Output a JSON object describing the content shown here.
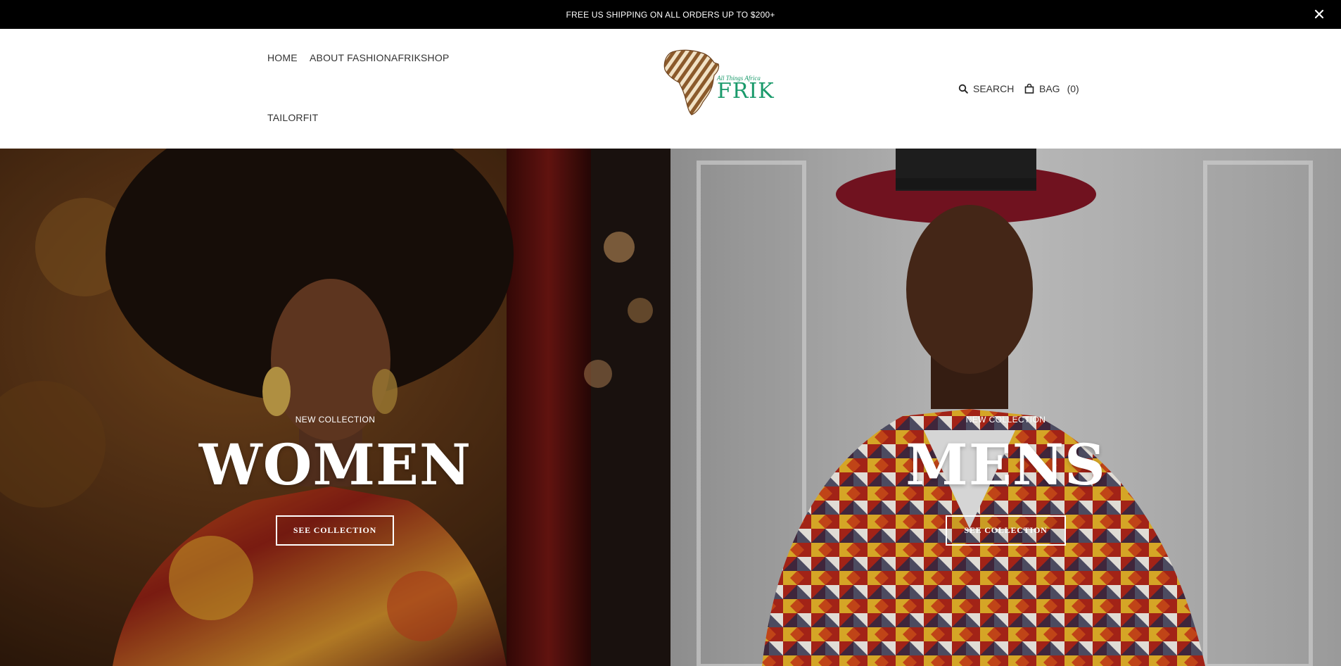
{
  "announcement": {
    "text": "FREE US SHIPPING ON ALL ORDERS UP TO $200+",
    "close_icon": "close-icon"
  },
  "nav": {
    "items": [
      {
        "label": "HOME"
      },
      {
        "label": "ABOUT FASHIONAFRIK"
      },
      {
        "label": "SHOP"
      },
      {
        "label": "TAILORFIT"
      }
    ]
  },
  "logo": {
    "tagline": "All Things Africa",
    "wordmark": "FRIK",
    "colors": {
      "brand_green": "#1a9a6b",
      "zebra_brown": "#8b5a2b"
    }
  },
  "utilities": {
    "search_label": "SEARCH",
    "search_icon": "search-icon",
    "bag_label": "BAG",
    "bag_count": "(0)",
    "bag_icon": "bag-icon"
  },
  "hero": {
    "women": {
      "eyebrow": "NEW COLLECTION",
      "title": "WOMEN",
      "button": "SEE COLLECTION"
    },
    "men": {
      "eyebrow": "NEW COLLECTION",
      "title": "MENS",
      "button": "SEE COLLECTION"
    }
  }
}
